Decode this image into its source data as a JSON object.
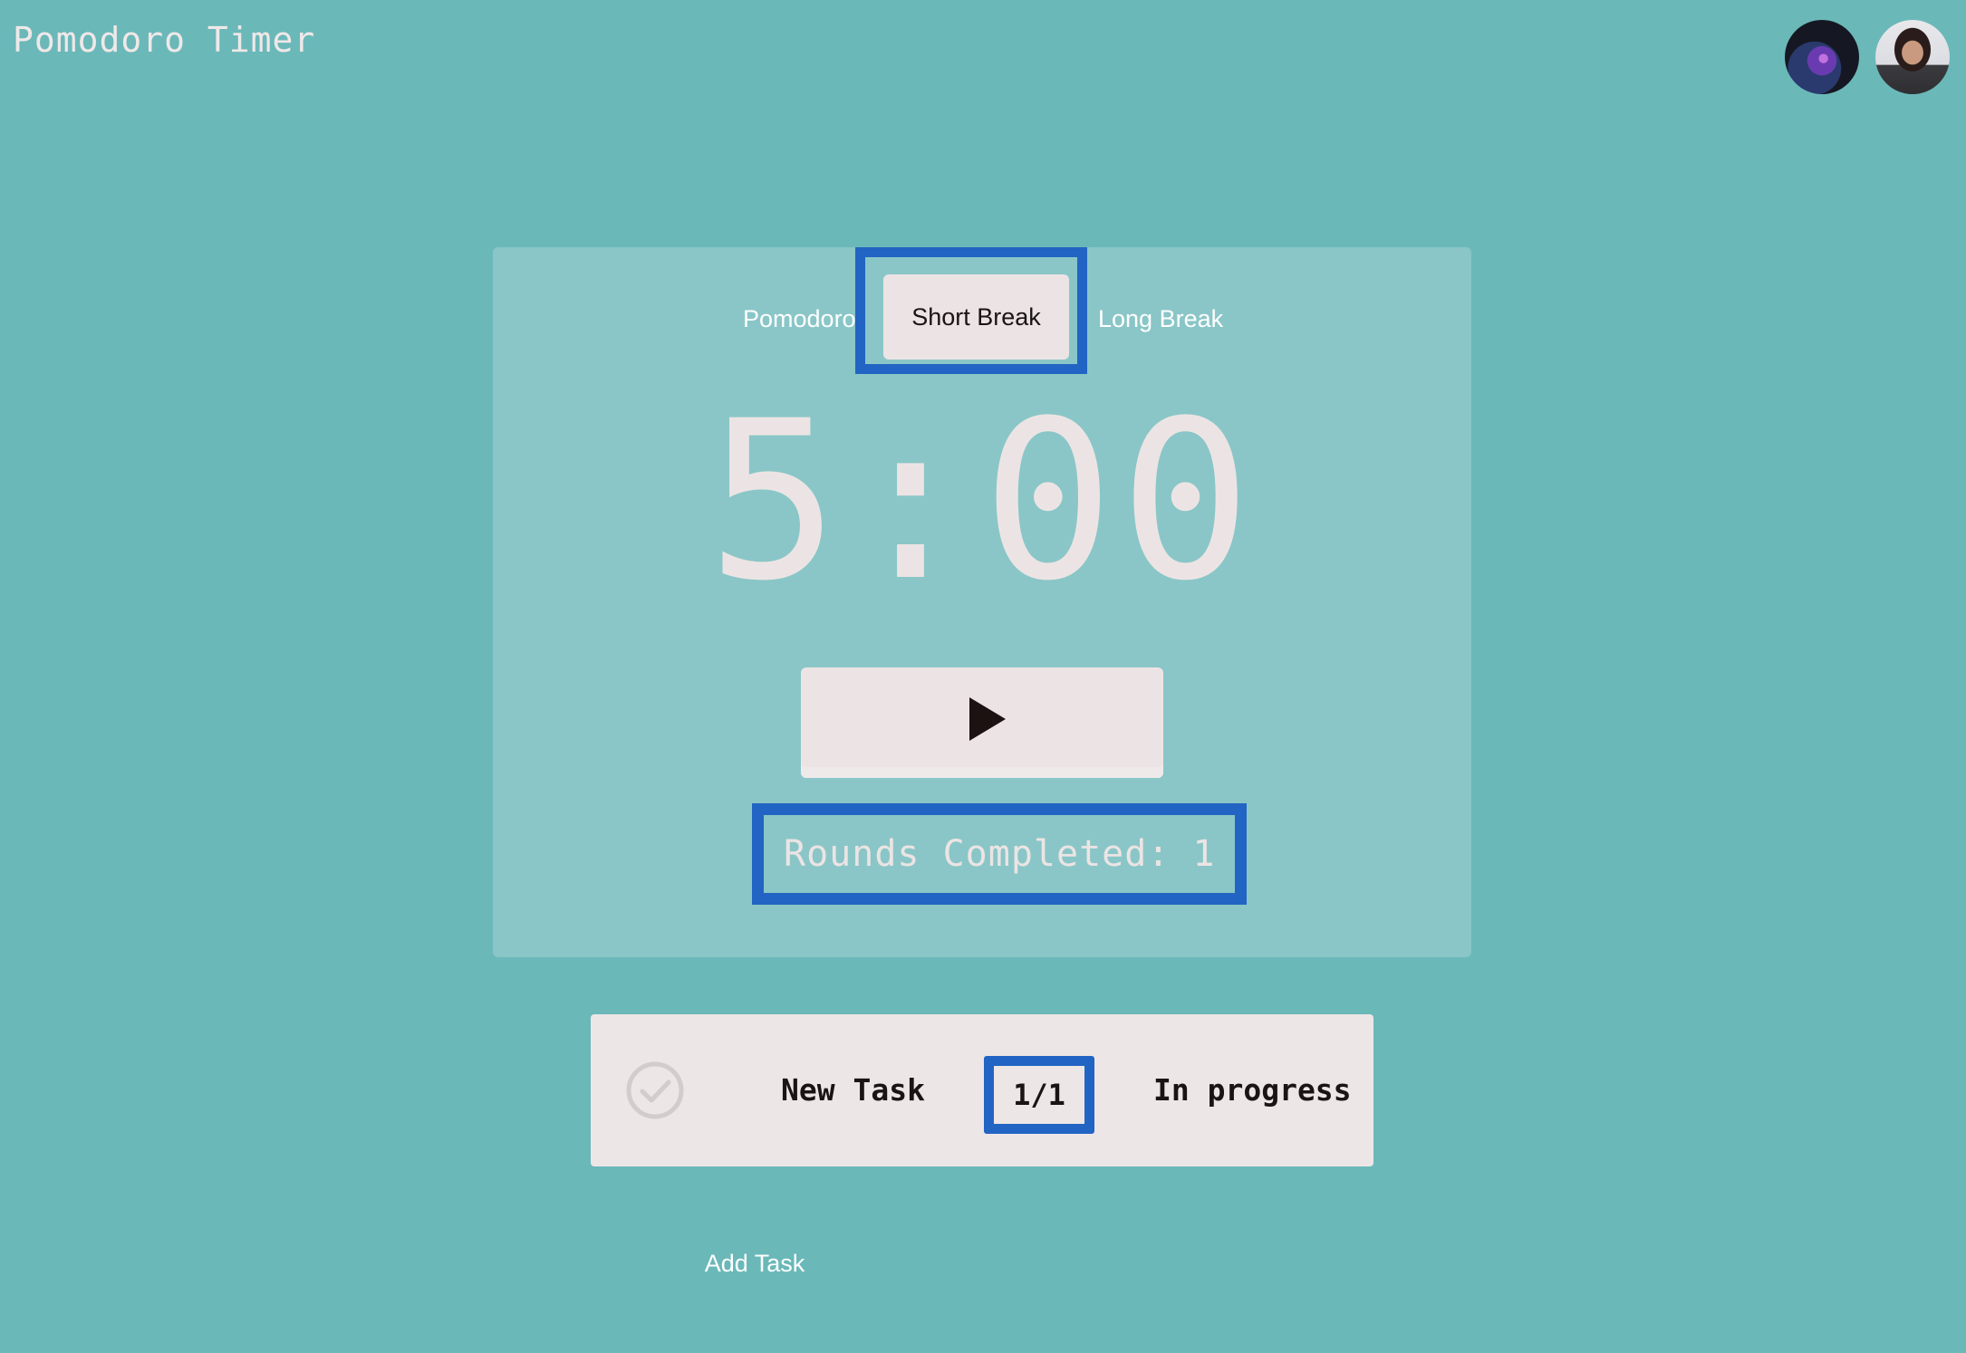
{
  "app": {
    "title": "Pomodoro Timer"
  },
  "header": {
    "avatars": [
      {
        "name": "avatar-galaxy"
      },
      {
        "name": "avatar-user-photo"
      }
    ]
  },
  "timer": {
    "tabs": [
      {
        "label": "Pomodoro",
        "selected": false
      },
      {
        "label": "Short Break",
        "selected": true
      },
      {
        "label": "Long Break",
        "selected": false
      }
    ],
    "time": "5:00",
    "play_icon": "play-icon",
    "rounds_text": "Rounds Completed: 1"
  },
  "tasks": {
    "items": [
      {
        "check_icon": "check-circle-icon",
        "name": "New Task",
        "count": "1/1",
        "status": "In progress"
      }
    ],
    "add_label": "Add Task"
  },
  "colors": {
    "background": "#6bb8b9",
    "card": "#8ac6c7",
    "highlight_outline": "#2264c3",
    "light": "#ece4e4",
    "dark_text": "#1a1414"
  }
}
